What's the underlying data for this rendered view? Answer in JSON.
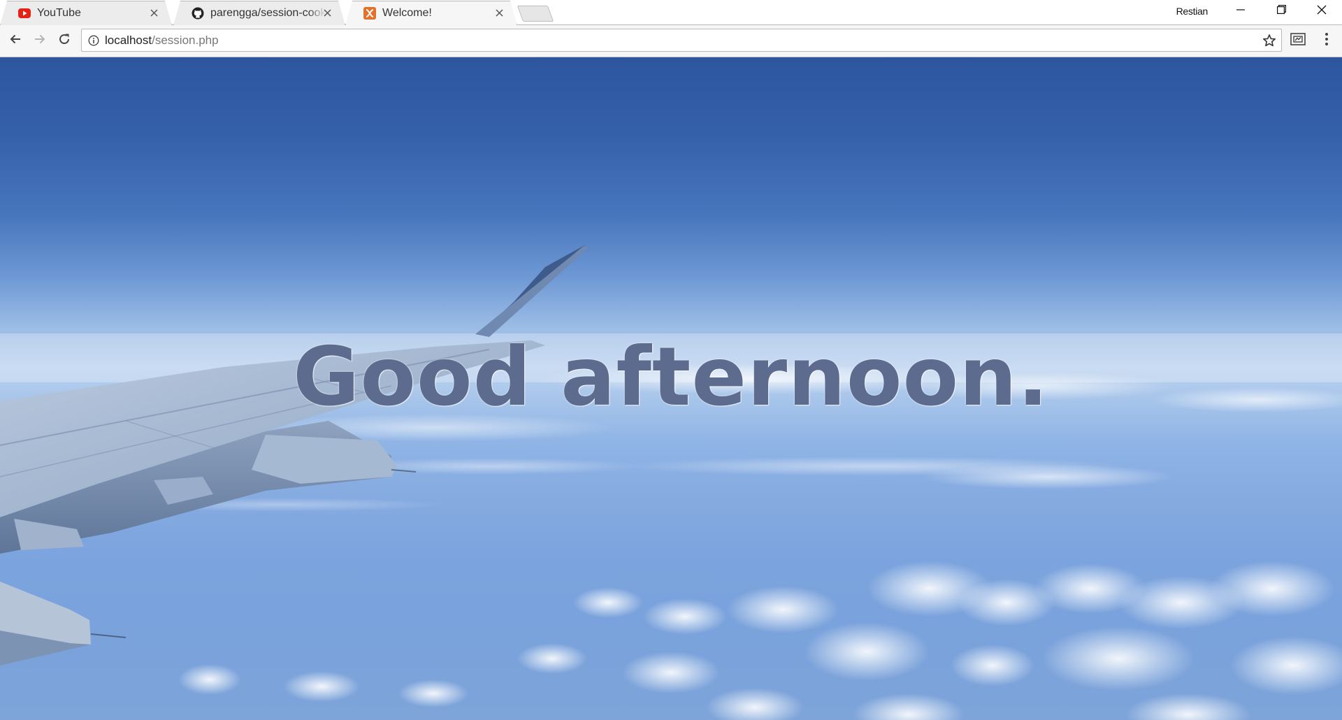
{
  "browser": {
    "tabs": [
      {
        "title": "YouTube",
        "icon": "youtube-icon",
        "active": false
      },
      {
        "title": "parengga/session-cookie",
        "icon": "github-icon",
        "active": false
      },
      {
        "title": "Welcome!",
        "icon": "xampp-icon",
        "active": true
      }
    ],
    "profile_name": "Restian",
    "address": {
      "host": "localhost",
      "path": "/session.php"
    }
  },
  "page": {
    "greeting": "Good afternoon."
  },
  "colors": {
    "youtube_red": "#e62117",
    "xampp_orange": "#e3712b",
    "greeting_text": "#5d6c8e"
  }
}
